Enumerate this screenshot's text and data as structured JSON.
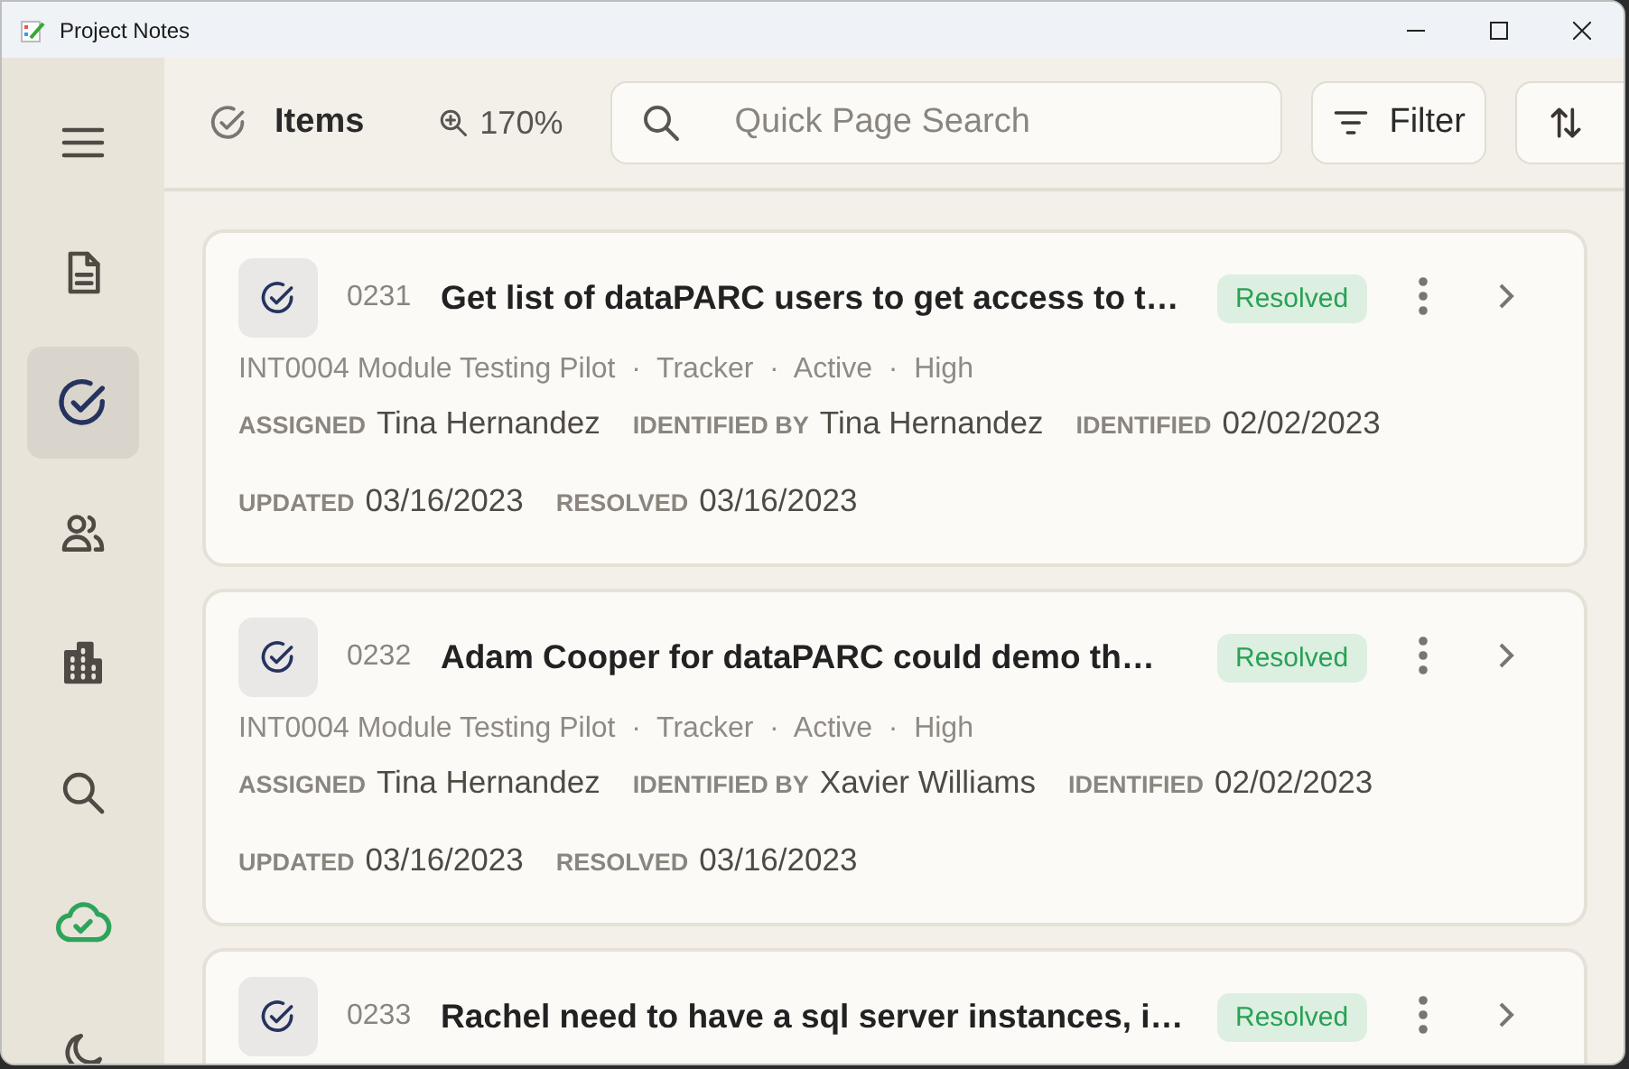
{
  "window": {
    "title": "Project Notes"
  },
  "sidebar": {
    "items": [
      {
        "kind": "menu",
        "selected": false
      },
      {
        "kind": "document",
        "selected": false
      },
      {
        "kind": "items",
        "selected": true
      },
      {
        "kind": "people",
        "selected": false
      },
      {
        "kind": "building",
        "selected": false
      },
      {
        "kind": "search",
        "selected": false
      },
      {
        "kind": "sync",
        "selected": false
      },
      {
        "kind": "theme",
        "selected": false
      }
    ]
  },
  "toolbar": {
    "title": "Items",
    "zoom": "170%",
    "search": {
      "placeholder": "Quick Page Search"
    },
    "filter_button": "Filter"
  },
  "items": [
    {
      "number": "0231",
      "title": "Get list of dataPARC users to get access to t…",
      "status": "Resolved",
      "meta": "INT0004 Module Testing Pilot  ·  Tracker  ·  Active  ·  High",
      "fields": [
        [
          {
            "label": "ASSIGNED",
            "value": "Tina Hernandez"
          },
          {
            "label": "IDENTIFIED BY",
            "value": "Tina Hernandez"
          },
          {
            "label": "IDENTIFIED",
            "value": "02/02/2023"
          }
        ],
        [
          {
            "label": "UPDATED",
            "value": "03/16/2023"
          },
          {
            "label": "RESOLVED",
            "value": "03/16/2023"
          }
        ]
      ]
    },
    {
      "number": "0232",
      "title": "Adam Cooper for dataPARC could demo th…",
      "status": "Resolved",
      "meta": "INT0004 Module Testing Pilot  ·  Tracker  ·  Active  ·  High",
      "fields": [
        [
          {
            "label": "ASSIGNED",
            "value": "Tina Hernandez"
          },
          {
            "label": "IDENTIFIED BY",
            "value": "Xavier Williams"
          },
          {
            "label": "IDENTIFIED",
            "value": "02/02/2023"
          }
        ],
        [
          {
            "label": "UPDATED",
            "value": "03/16/2023"
          },
          {
            "label": "RESOLVED",
            "value": "03/16/2023"
          }
        ]
      ]
    },
    {
      "number": "0233",
      "title": "Rachel need to have a sql server instances, i…",
      "status": "Resolved"
    }
  ]
}
